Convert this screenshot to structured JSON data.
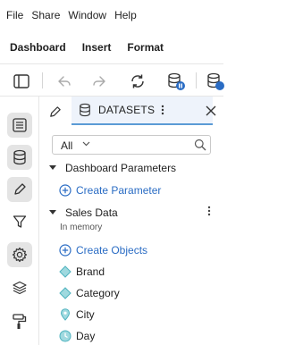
{
  "menu": {
    "file": "File",
    "share": "Share",
    "window": "Window",
    "help": "Help"
  },
  "toolbar": {
    "dashboard": "Dashboard",
    "insert": "Insert",
    "format": "Format"
  },
  "panel": {
    "tab_label": "DATASETS",
    "filter": {
      "selected": "All"
    },
    "sections": [
      {
        "title": "Dashboard Parameters",
        "action": "Create Parameter"
      },
      {
        "title": "Sales Data",
        "subtitle": "In memory",
        "action": "Create Objects",
        "fields": [
          {
            "name": "Brand",
            "icon": "diamond-icon"
          },
          {
            "name": "Category",
            "icon": "diamond-icon"
          },
          {
            "name": "City",
            "icon": "location-pin-icon"
          },
          {
            "name": "Day",
            "icon": "clock-icon"
          }
        ]
      }
    ]
  },
  "colors": {
    "accent": "#2a6cc4",
    "tab_highlight": "#eef3fb",
    "dimension": "#4fb3bf"
  }
}
